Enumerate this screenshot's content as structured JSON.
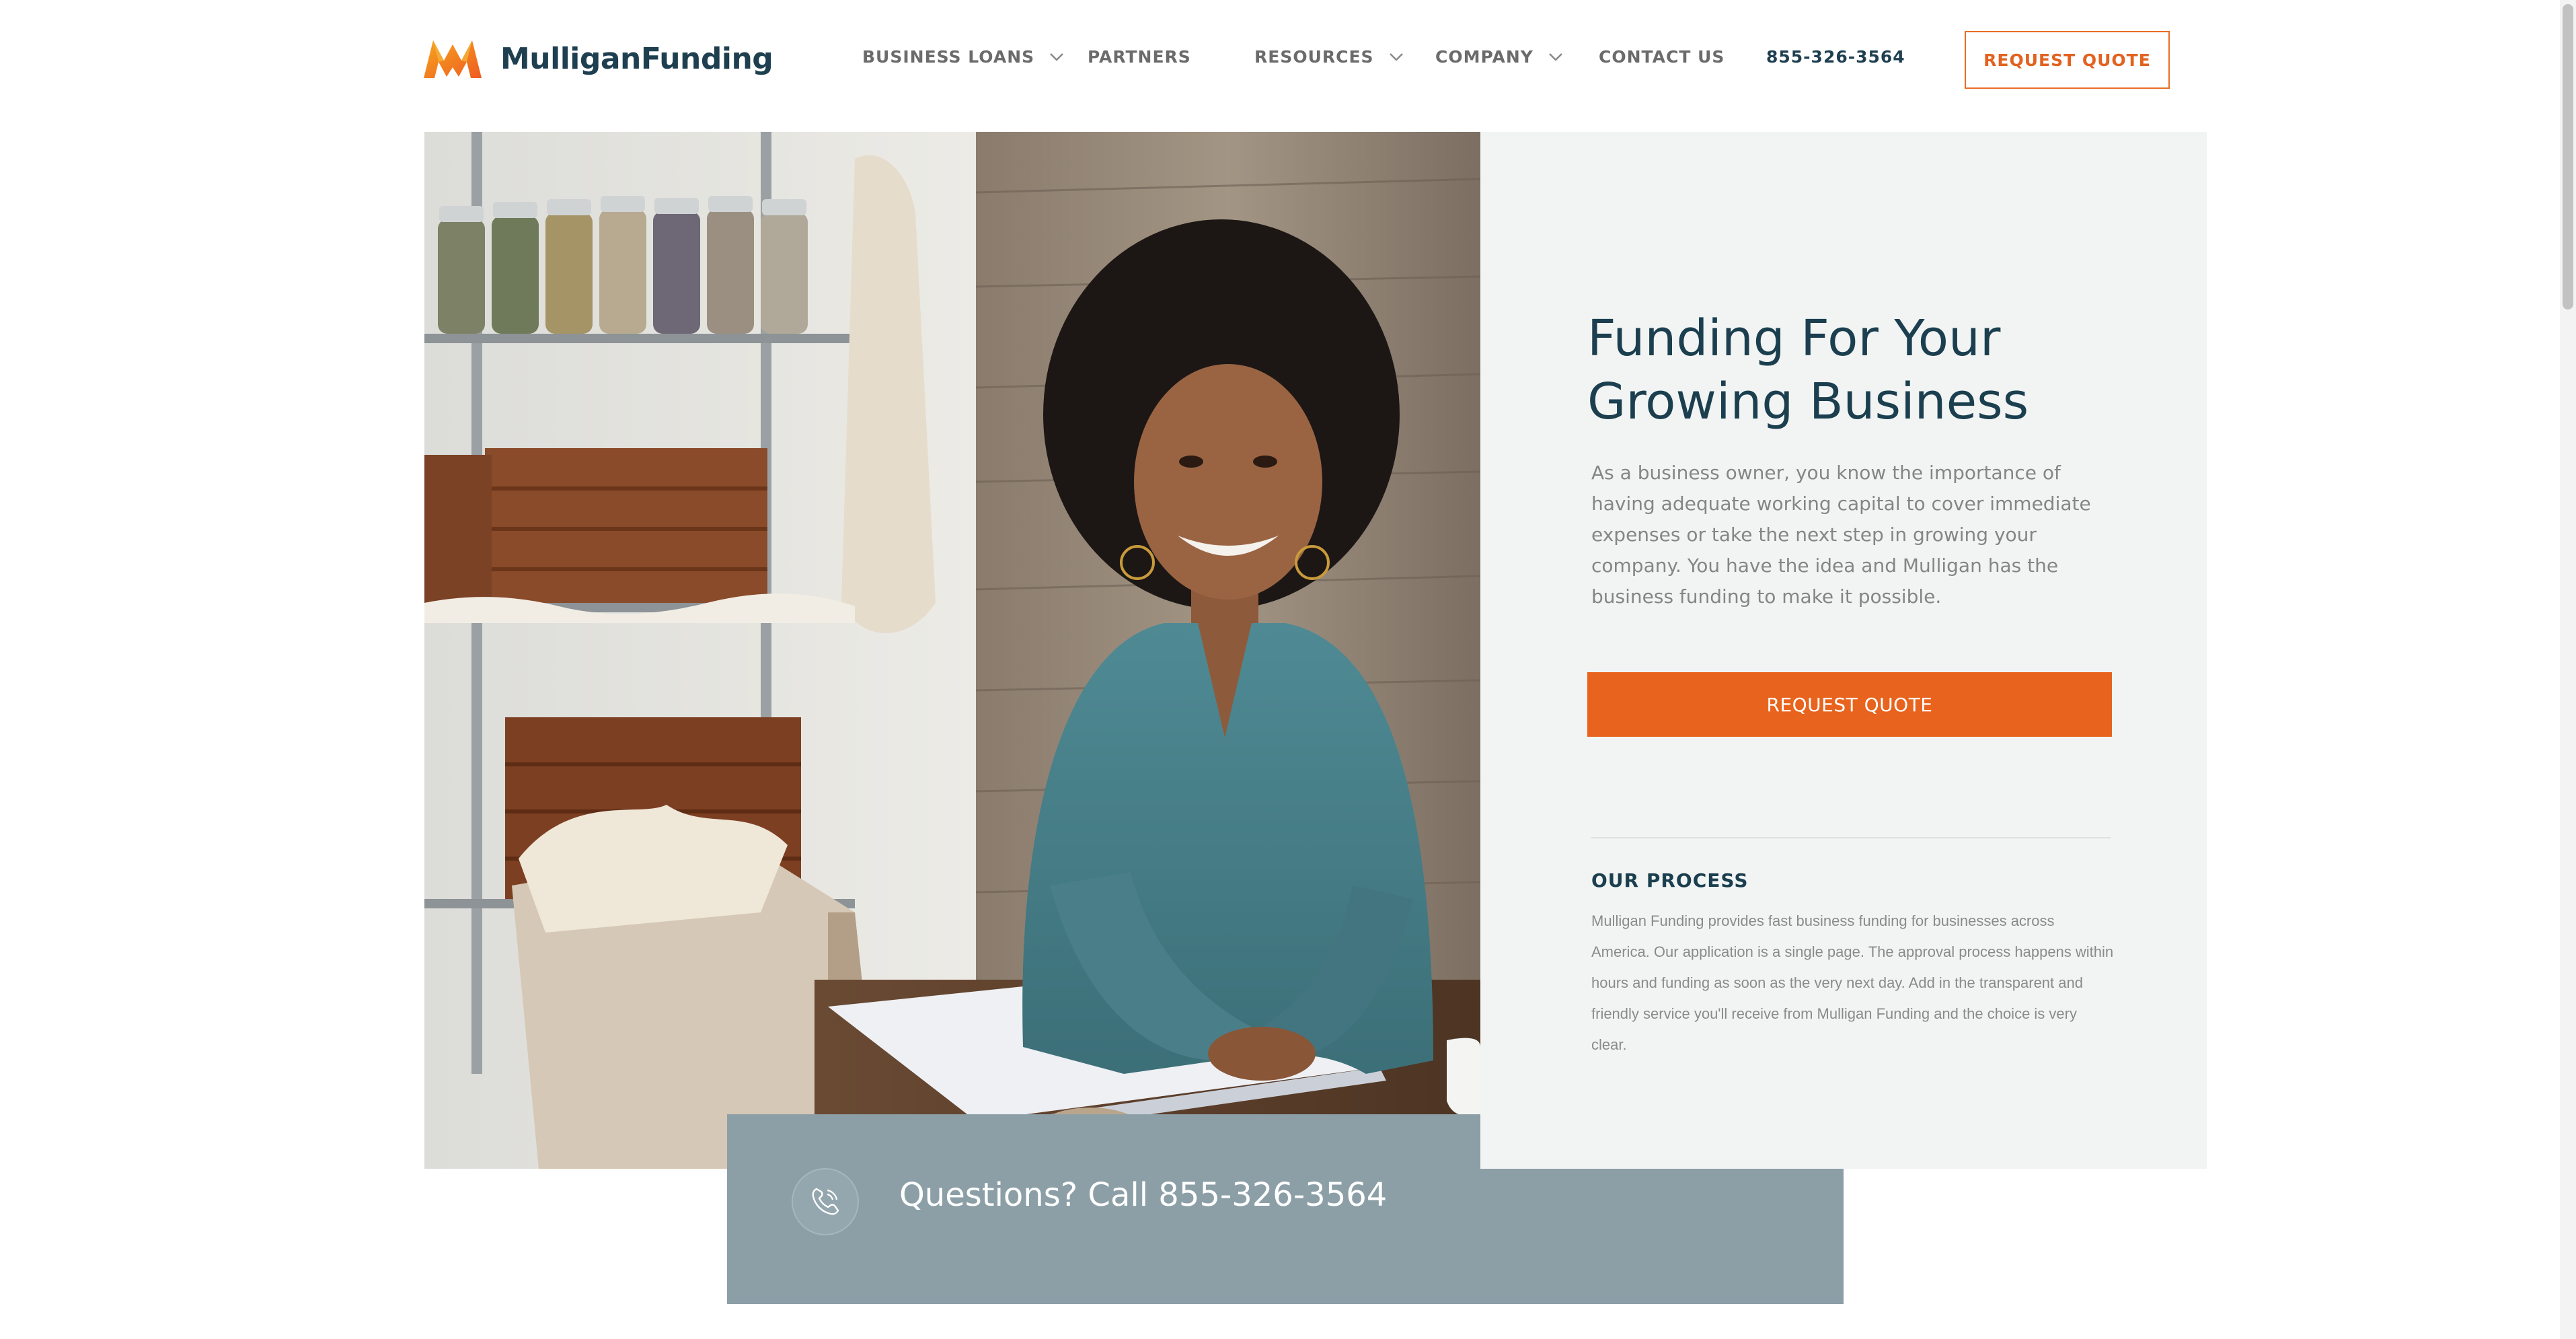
{
  "header": {
    "logo_text": "MulliganFunding",
    "nav": [
      {
        "label": "BUSINESS LOANS",
        "has_dropdown": true
      },
      {
        "label": "PARTNERS",
        "has_dropdown": false
      },
      {
        "label": "RESOURCES",
        "has_dropdown": true
      },
      {
        "label": "COMPANY",
        "has_dropdown": true
      },
      {
        "label": "CONTACT US",
        "has_dropdown": false
      }
    ],
    "phone": "855-326-3564",
    "cta_label": "REQUEST QUOTE"
  },
  "hero": {
    "title_line1": "Funding For Your",
    "title_line2": "Growing Business",
    "body": "As a business owner, you know the importance of having adequate working capital to cover immediate expenses or take the next step in growing your company. You have the idea and Mulligan has the business funding to make it possible.",
    "cta_label": "REQUEST QUOTE"
  },
  "process": {
    "heading": "OUR PROCESS",
    "body": "Mulligan Funding provides fast business funding for businesses across America. Our application is a single page. The approval process happens within hours and funding as soon as the very next day. Add in the transparent and friendly service you'll receive from Mulligan Funding and the choice is very clear."
  },
  "callbox": {
    "text": "Questions? Call 855-326-3564"
  },
  "icons": {
    "logo": "mulligan-m-logo",
    "dropdown": "chevron-down-icon",
    "phone": "phone-icon"
  },
  "colors": {
    "brand_navy": "#1e3f50",
    "brand_orange": "#e8641e",
    "panel_bg": "#f2f4f4",
    "callbox_bg": "#8c9fa7"
  }
}
